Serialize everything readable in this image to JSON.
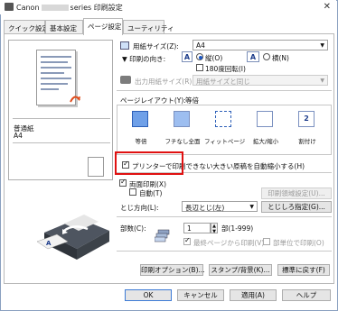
{
  "window": {
    "title_prefix": "Canon",
    "title_suffix": "series 印刷設定",
    "close_glyph": "✕"
  },
  "tabs": [
    {
      "label": "クイック設定",
      "active": false
    },
    {
      "label": "基本設定",
      "active": false
    },
    {
      "label": "ページ設定",
      "active": true
    },
    {
      "label": "ユーティリティ",
      "active": false
    }
  ],
  "preview": {
    "media_label": "普通紙",
    "size_label": "A4"
  },
  "page_settings": {
    "paper_size_label": "用紙サイズ(Z):",
    "paper_size_value": "A4",
    "orientation_label": "印刷の向き:",
    "portrait_label": "縦(O)",
    "landscape_label": "横(N)",
    "rotate180_label": "180度回転(I)",
    "output_size_label": "出力用紙サイズ(R):",
    "output_size_value": "用紙サイズと同じ",
    "layout_label": "ページレイアウト(Y):",
    "layout_value": "等倍",
    "layout_items": [
      {
        "label": "等倍",
        "selected": true
      },
      {
        "label": "フチなし全面",
        "selected": false
      },
      {
        "label": "フィットページ",
        "selected": false
      },
      {
        "label": "拡大/縮小",
        "selected": false
      },
      {
        "label": "割付け",
        "selected": false
      }
    ],
    "layout_item5_badge": "2",
    "shrink_label": "プリンターで印刷できない大きい原稿を自動縮小する(H)",
    "duplex_label": "両面印刷(X)",
    "auto_label": "自動(T)",
    "duplex_settings_btn": "印刷領域設定(U)...",
    "binding_label": "とじ方向(L):",
    "binding_value": "長辺とじ(左)",
    "binding_margin_btn": "とじしろ指定(G)...",
    "copies_label": "部数(C):",
    "copies_value": "1",
    "copies_range": "部(1-999)",
    "last_page_label": "最終ページから印刷(V)",
    "collate_label": "部単位で印刷(O)",
    "print_options_btn": "印刷オプション(B)...",
    "stamp_btn": "スタンプ/背景(K)...",
    "defaults_btn": "標準に戻す(F)"
  },
  "footer": {
    "ok": "OK",
    "cancel": "キャンセル",
    "apply": "適用(A)",
    "help": "ヘルプ"
  },
  "colors": {
    "highlight_box": "#e01010",
    "accent": "#1a56c4"
  },
  "checkbox_states": {
    "rotate180": false,
    "shrink": true,
    "duplex": true,
    "auto": false,
    "last_page": true,
    "collate": false
  }
}
